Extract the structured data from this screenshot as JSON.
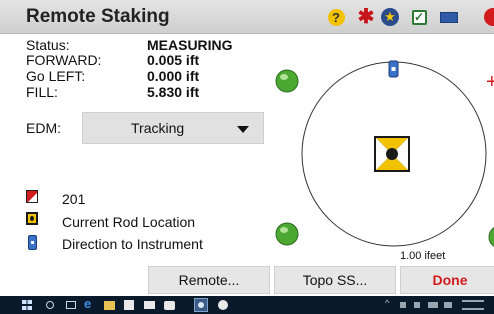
{
  "window": {
    "title": "Remote Staking",
    "toolbar_icons": [
      "help-icon",
      "laser-icon",
      "star-icon",
      "check-icon",
      "battery-icon",
      "close-icon"
    ],
    "help_glyph": "?"
  },
  "status": {
    "status_label": "Status:",
    "status_value": "MEASURING",
    "forward_label": "FORWARD:",
    "forward_value": "0.005 ift",
    "goleft_label": "Go LEFT:",
    "goleft_value": "0.000 ift",
    "fill_label": "FILL:",
    "fill_value": "5.830 ift"
  },
  "edm": {
    "label": "EDM:",
    "selected": "Tracking"
  },
  "legend": {
    "point_label": "201",
    "rod_label": "Current Rod Location",
    "direction_label": "Direction to Instrument"
  },
  "graphic": {
    "scale_label": "1.00 ifeet",
    "right_marker": "+"
  },
  "buttons": {
    "remote": "Remote...",
    "topo": "Topo SS...",
    "done": "Done"
  },
  "colors": {
    "accent_red": "#d01c1c",
    "rod_yellow": "#f0c200",
    "instrument_blue": "#3a70c6",
    "target_green": "#4ca832"
  }
}
